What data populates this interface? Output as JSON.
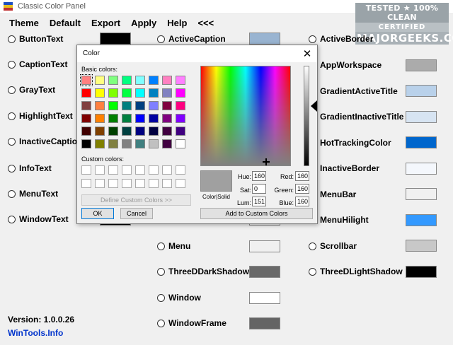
{
  "window": {
    "title": "Classic Color Panel"
  },
  "watermark": {
    "line1": "TESTED ★ 100% CLEAN",
    "line2": "CERTIFIED",
    "line3": "MAJORGEEKS.COM"
  },
  "menu": [
    "Theme",
    "Default",
    "Export",
    "Apply",
    "Help",
    "<<<"
  ],
  "colors": {
    "col1": [
      {
        "label": "ButtonText",
        "color": "#000000"
      },
      {
        "label": "CaptionText"
      },
      {
        "label": "GrayText"
      },
      {
        "label": "HighlightText"
      },
      {
        "label": "InactiveCaption"
      },
      {
        "label": "InfoText"
      },
      {
        "label": "MenuText"
      },
      {
        "label": "WindowText",
        "color": "#000000"
      }
    ],
    "col2": [
      {
        "label": "ActiveCaption",
        "color": "#99b4d1"
      },
      {
        "label": "Menu",
        "color": "#f0f0f0"
      },
      {
        "label": "ThreeDDarkShadow",
        "color": "#696969"
      },
      {
        "label": "Window",
        "color": "#ffffff"
      },
      {
        "label": "WindowFrame",
        "color": "#646464"
      }
    ],
    "col3": [
      {
        "label": "ActiveBorder"
      },
      {
        "label": "AppWorkspace",
        "color": "#ababab"
      },
      {
        "label": "GradientActiveTitle",
        "color": "#b9d1ea"
      },
      {
        "label": "GradientInactiveTitle",
        "color": "#d7e4f2"
      },
      {
        "label": "HotTrackingColor",
        "color": "#0066cc"
      },
      {
        "label": "InactiveBorder",
        "color": "#f4f7fc"
      },
      {
        "label": "MenuBar",
        "color": "#f0f0f0"
      },
      {
        "label": "MenuHilight",
        "color": "#3399ff"
      },
      {
        "label": "Scrollbar",
        "color": "#c8c8c8"
      },
      {
        "label": "ThreeDLightShadow",
        "color": "#000000"
      }
    ]
  },
  "footer": {
    "version": "Version: 1.0.0.26",
    "link": "WinTools.Info"
  },
  "dialog": {
    "title": "Color",
    "close": "✕",
    "basic_label": "Basic colors:",
    "custom_label": "Custom colors:",
    "define_button": "Define Custom Colors >>",
    "ok": "OK",
    "cancel": "Cancel",
    "color_solid": "Color|Solid",
    "add_button": "Add to Custom Colors",
    "hue_label": "Hue:",
    "hue": "160",
    "sat_label": "Sat:",
    "sat": "0",
    "lum_label": "Lum:",
    "lum": "151",
    "red_label": "Red:",
    "red": "160",
    "green_label": "Green:",
    "green": "160",
    "blue_label": "Blue:",
    "blue": "160",
    "preview_color": "#a0a0a0",
    "basic_colors": [
      "#ff8080",
      "#ffff80",
      "#80ff80",
      "#00ff80",
      "#80ffff",
      "#0080ff",
      "#ff80c0",
      "#ff80ff",
      "#ff0000",
      "#ffff00",
      "#80ff00",
      "#00ff40",
      "#00ffff",
      "#0080c0",
      "#8080c0",
      "#ff00ff",
      "#804040",
      "#ff8040",
      "#00ff00",
      "#008080",
      "#004080",
      "#8080ff",
      "#800040",
      "#ff0080",
      "#800000",
      "#ff8000",
      "#008000",
      "#008040",
      "#0000ff",
      "#0000a0",
      "#800080",
      "#8000ff",
      "#400000",
      "#804000",
      "#004000",
      "#004040",
      "#000080",
      "#000040",
      "#400040",
      "#400080",
      "#000000",
      "#808000",
      "#808040",
      "#808080",
      "#408080",
      "#c0c0c0",
      "#400040",
      "#ffffff"
    ]
  }
}
